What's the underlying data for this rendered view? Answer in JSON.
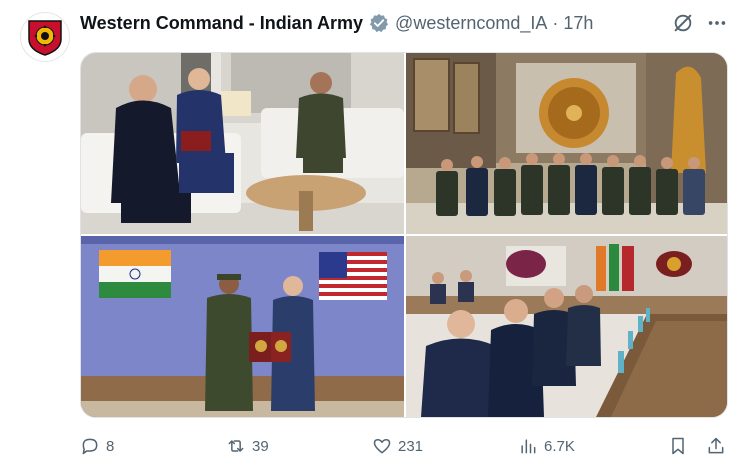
{
  "tweet": {
    "display_name": "Western Command - Indian Army",
    "handle": "@westerncomd_IA",
    "separator": "·",
    "time": "17h",
    "verified_icon": "verified-badge-icon",
    "accent_color": "#1d9bf0"
  },
  "media": {
    "photos": [
      {
        "name": "meeting-lounge-photo",
        "description_icon": "photo"
      },
      {
        "name": "conference-hall-group-photo",
        "description_icon": "photo"
      },
      {
        "name": "memento-exchange-photo",
        "description_icon": "photo"
      },
      {
        "name": "boardroom-meeting-photo",
        "description_icon": "photo"
      }
    ]
  },
  "actions": {
    "replies": "8",
    "reposts": "39",
    "likes": "231",
    "views": "6.7K"
  }
}
